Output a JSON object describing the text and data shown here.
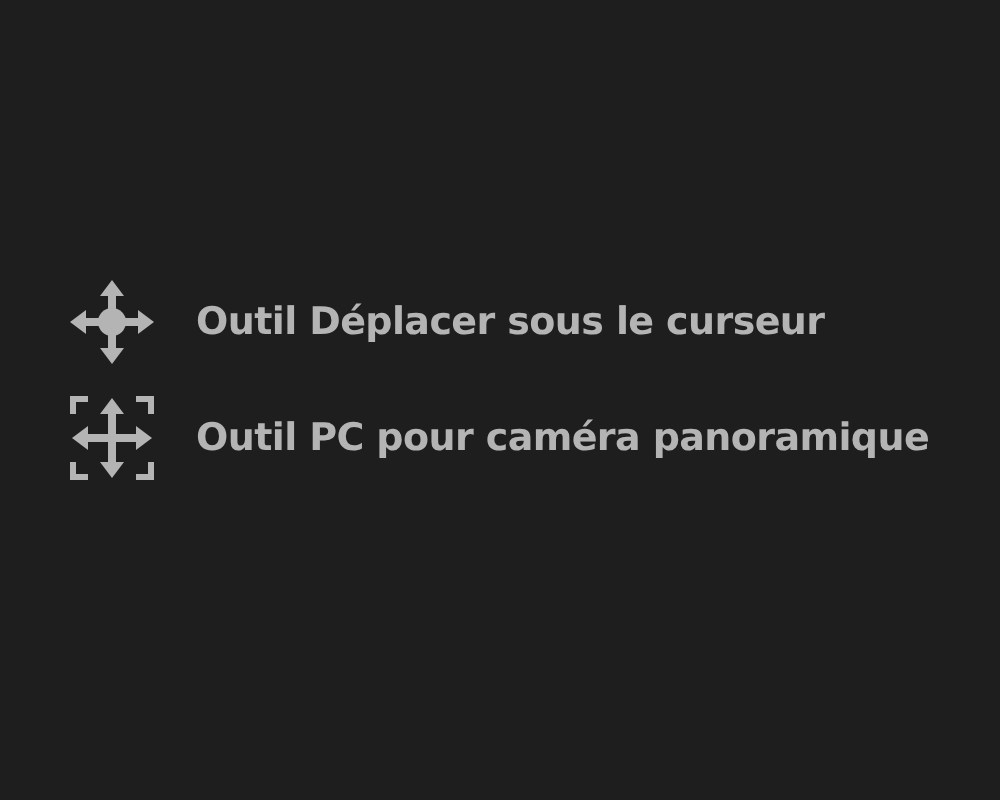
{
  "tools": [
    {
      "kind": "move",
      "label": "Outil Déplacer sous le curseur"
    },
    {
      "kind": "frame-move",
      "label": "Outil PC pour caméra panoramique"
    }
  ]
}
